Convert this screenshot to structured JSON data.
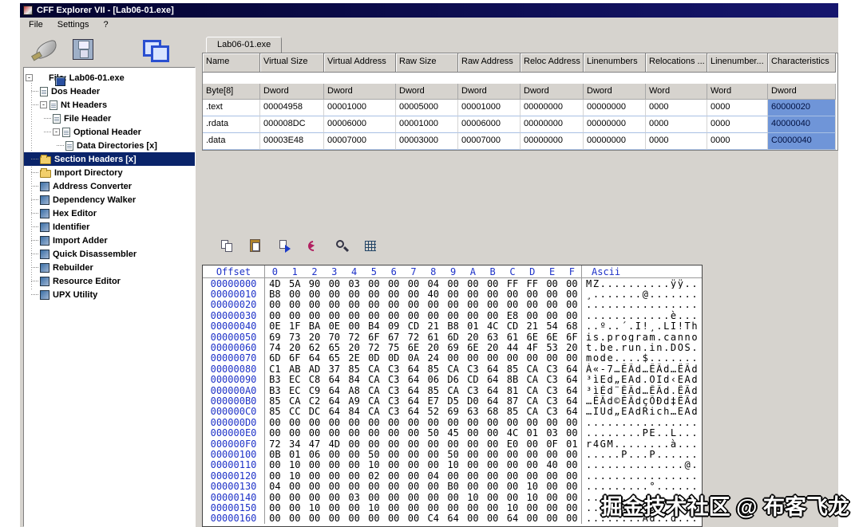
{
  "window": {
    "title": "CFF Explorer VII - [Lab06-01.exe]",
    "menu": [
      "File",
      "Settings",
      "?"
    ]
  },
  "tab": {
    "label": "Lab06-01.exe"
  },
  "tree": {
    "items": [
      {
        "label": "File: Lab06-01.exe",
        "level": 0,
        "icon": "app",
        "expander": true
      },
      {
        "label": "Dos Header",
        "level": 1,
        "icon": "doc"
      },
      {
        "label": "Nt Headers",
        "level": 1,
        "icon": "doc",
        "expander": true
      },
      {
        "label": "File Header",
        "level": 2,
        "icon": "doc"
      },
      {
        "label": "Optional Header",
        "level": 2,
        "icon": "doc",
        "expander": true
      },
      {
        "label": "Data Directories [x]",
        "level": 3,
        "icon": "doc"
      },
      {
        "label": "Section Headers [x]",
        "level": 1,
        "icon": "folder",
        "selected": true
      },
      {
        "label": "Import Directory",
        "level": 1,
        "icon": "folder"
      },
      {
        "label": "Address Converter",
        "level": 1,
        "icon": "tool"
      },
      {
        "label": "Dependency Walker",
        "level": 1,
        "icon": "tool"
      },
      {
        "label": "Hex Editor",
        "level": 1,
        "icon": "tool"
      },
      {
        "label": "Identifier",
        "level": 1,
        "icon": "tool"
      },
      {
        "label": "Import Adder",
        "level": 1,
        "icon": "tool"
      },
      {
        "label": "Quick Disassembler",
        "level": 1,
        "icon": "tool"
      },
      {
        "label": "Rebuilder",
        "level": 1,
        "icon": "tool"
      },
      {
        "label": "Resource Editor",
        "level": 1,
        "icon": "tool"
      },
      {
        "label": "UPX Utility",
        "level": 1,
        "icon": "tool"
      }
    ]
  },
  "sections_table": {
    "columns": [
      "Name",
      "Virtual Size",
      "Virtual Address",
      "Raw Size",
      "Raw Address",
      "Reloc Address",
      "Linenumbers",
      "Relocations ...",
      "Linenumber...",
      "Characteristics"
    ],
    "types": [
      "Byte[8]",
      "Dword",
      "Dword",
      "Dword",
      "Dword",
      "Dword",
      "Dword",
      "Word",
      "Word",
      "Dword"
    ],
    "rows": [
      {
        "cells": [
          ".text",
          "00004958",
          "00001000",
          "00005000",
          "00001000",
          "00000000",
          "00000000",
          "0000",
          "0000",
          "60000020"
        ]
      },
      {
        "cells": [
          ".rdata",
          "000008DC",
          "00006000",
          "00001000",
          "00006000",
          "00000000",
          "00000000",
          "0000",
          "0000",
          "40000040"
        ]
      },
      {
        "cells": [
          ".data",
          "00003E48",
          "00007000",
          "00003000",
          "00007000",
          "00000000",
          "00000000",
          "0000",
          "0000",
          "C0000040"
        ]
      }
    ]
  },
  "hex_editor": {
    "header": {
      "offset_label": "Offset",
      "byte_labels": [
        "0",
        "1",
        "2",
        "3",
        "4",
        "5",
        "6",
        "7",
        "8",
        "9",
        "A",
        "B",
        "C",
        "D",
        "E",
        "F"
      ],
      "ascii_label": "Ascii"
    },
    "rows": [
      {
        "offset": "00000000",
        "bytes": "4D 5A 90 00 03 00 00 00 04 00 00 00 FF FF 00 00",
        "ascii": "MZ..........ÿÿ.."
      },
      {
        "offset": "00000010",
        "bytes": "B8 00 00 00 00 00 00 00 40 00 00 00 00 00 00 00",
        "ascii": "¸.......@......."
      },
      {
        "offset": "00000020",
        "bytes": "00 00 00 00 00 00 00 00 00 00 00 00 00 00 00 00",
        "ascii": "................"
      },
      {
        "offset": "00000030",
        "bytes": "00 00 00 00 00 00 00 00 00 00 00 00 E8 00 00 00",
        "ascii": "............è..."
      },
      {
        "offset": "00000040",
        "bytes": "0E 1F BA 0E 00 B4 09 CD 21 B8 01 4C CD 21 54 68",
        "ascii": "..º..´.Í!¸.LÍ!Th"
      },
      {
        "offset": "00000050",
        "bytes": "69 73 20 70 72 6F 67 72 61 6D 20 63 61 6E 6E 6F",
        "ascii": "is.program.canno"
      },
      {
        "offset": "00000060",
        "bytes": "74 20 62 65 20 72 75 6E 20 69 6E 20 44 4F 53 20",
        "ascii": "t.be.run.in.DOS."
      },
      {
        "offset": "00000070",
        "bytes": "6D 6F 64 65 2E 0D 0D 0A 24 00 00 00 00 00 00 00",
        "ascii": "mode....$......."
      },
      {
        "offset": "00000080",
        "bytes": "C1 AB AD 37 85 CA C3 64 85 CA C3 64 85 CA C3 64",
        "ascii": "Á«-7…ÊÃd…ÊÃd…ÊÃd"
      },
      {
        "offset": "00000090",
        "bytes": "B3 EC C8 64 84 CA C3 64 06 D6 CD 64 8B CA C3 64",
        "ascii": "³ìÈd„ÊÃd.ÖÍd‹ÊÃd"
      },
      {
        "offset": "000000A0",
        "bytes": "B3 EC C9 64 A8 CA C3 64 85 CA C3 64 81 CA C3 64",
        "ascii": "³ìÉd¨ÊÃd…ÊÃd.ÊÃd"
      },
      {
        "offset": "000000B0",
        "bytes": "85 CA C2 64 A9 CA C3 64 E7 D5 D0 64 87 CA C3 64",
        "ascii": "…ÊÂd©ÊÃdçÕÐd‡ÊÃd"
      },
      {
        "offset": "000000C0",
        "bytes": "85 CC DC 64 84 CA C3 64 52 69 63 68 85 CA C3 64",
        "ascii": "…ÌÜd„ÊÃdRich…ÊÃd"
      },
      {
        "offset": "000000D0",
        "bytes": "00 00 00 00 00 00 00 00 00 00 00 00 00 00 00 00",
        "ascii": "................"
      },
      {
        "offset": "000000E0",
        "bytes": "00 00 00 00 00 00 00 00 50 45 00 00 4C 01 03 00",
        "ascii": "........PE..L..."
      },
      {
        "offset": "000000F0",
        "bytes": "72 34 47 4D 00 00 00 00 00 00 00 00 E0 00 0F 01",
        "ascii": "r4GM........à..."
      },
      {
        "offset": "00000100",
        "bytes": "0B 01 06 00 00 50 00 00 00 50 00 00 00 00 00 00",
        "ascii": ".....P...P......"
      },
      {
        "offset": "00000110",
        "bytes": "00 10 00 00 00 10 00 00 00 10 00 00 00 00 40 00",
        "ascii": "..............@."
      },
      {
        "offset": "00000120",
        "bytes": "00 10 00 00 00 02 00 00 04 00 00 00 00 00 00 00",
        "ascii": "................"
      },
      {
        "offset": "00000130",
        "bytes": "04 00 00 00 00 00 00 00 00 B0 00 00 00 10 00 00",
        "ascii": ".........°......"
      },
      {
        "offset": "00000140",
        "bytes": "00 00 00 00 03 00 00 00 00 00 10 00 00 10 00 00",
        "ascii": "................"
      },
      {
        "offset": "00000150",
        "bytes": "00 00 10 00 00 10 00 00 00 00 00 00 10 00 00 00",
        "ascii": "................"
      },
      {
        "offset": "00000160",
        "bytes": "00 00 00 00 00 00 00 00 C4 64 00 00 64 00 00 00",
        "ascii": "........Äd..d..."
      }
    ]
  },
  "watermark": {
    "text": "掘金技术社区 @ 布客飞龙"
  },
  "colors": {
    "titlebar_start": "#03032e",
    "titlebar_end": "#16166e",
    "tree_selection": "#0a246a",
    "cell_highlight": "#6f95d8",
    "hex_label_text": "#1e32c8",
    "chrome": "#D6D3CE"
  }
}
